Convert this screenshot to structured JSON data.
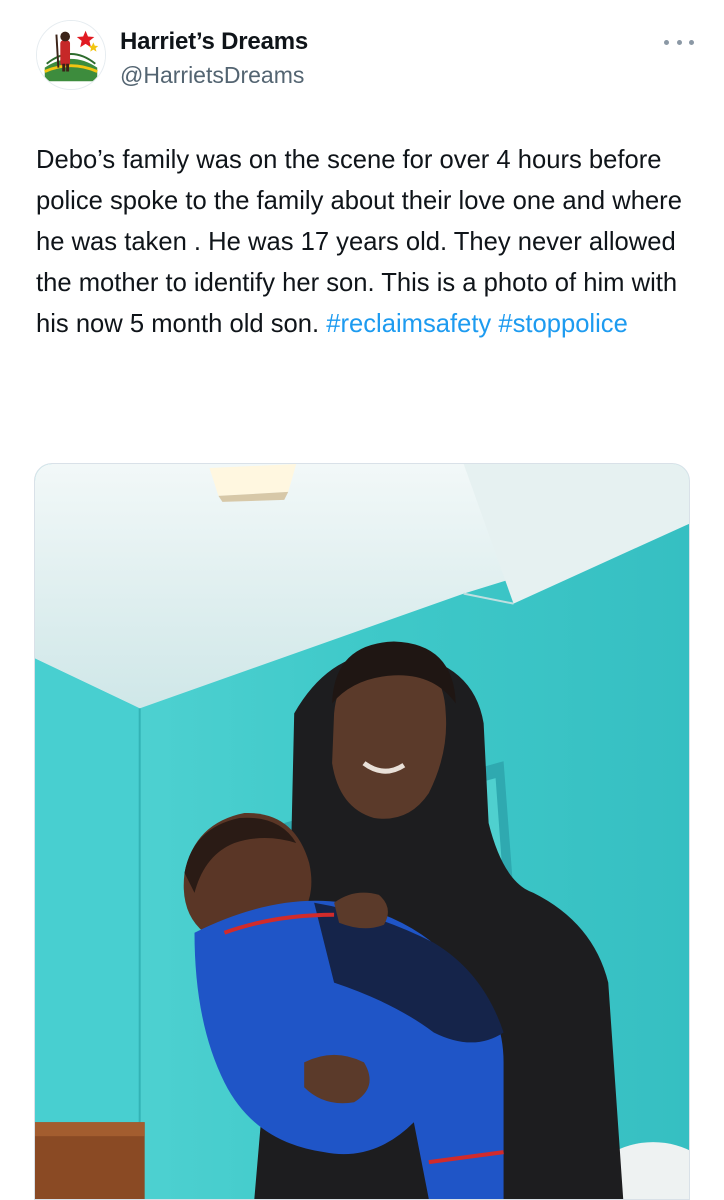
{
  "author": {
    "display_name": "Harriet’s Dreams",
    "handle": "@HarrietsDreams",
    "avatar_icon": "harriets-dreams-logo"
  },
  "menu": {
    "icon": "more-options-icon"
  },
  "tweet": {
    "text_parts": [
      {
        "kind": "text",
        "value": "Debo’s family was on the scene for over 4 hours before police spoke to the family about their love one and where he was taken . He was 17 years old. They never allowed the mother to identify her son. This is a photo of him with his now 5 month old son. "
      },
      {
        "kind": "hashtag",
        "value": "#reclaimsafety"
      },
      {
        "kind": "text",
        "value": " "
      },
      {
        "kind": "hashtag",
        "value": "#stoppolice"
      }
    ]
  },
  "media": {
    "kind": "photo",
    "colors": {
      "wall": "#3fc9c9",
      "ceiling": "#dfeeee",
      "hoodie": "#1d1d1f",
      "snowsuit": "#1f55c7",
      "skin": "#5b3a2a"
    }
  },
  "colors": {
    "hashtag": "#1d9bf0",
    "secondary_text": "#536471"
  }
}
